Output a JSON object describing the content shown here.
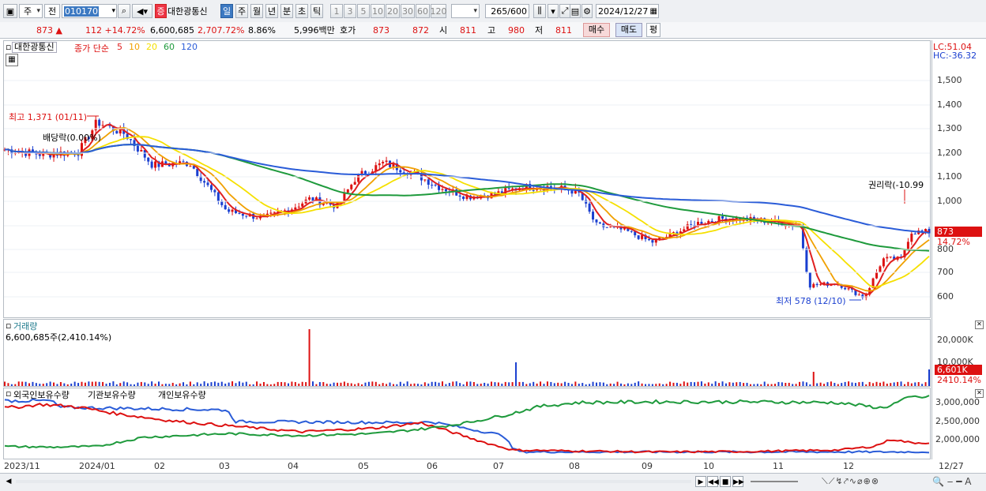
{
  "toolbar": {
    "period_type": "주",
    "prev_label": "전",
    "stock_code": "010170",
    "security_tag": "증",
    "stock_name": "대한광통신",
    "periods": [
      "일",
      "주",
      "월",
      "년",
      "분",
      "초",
      "틱"
    ],
    "minutes": [
      "1",
      "3",
      "5",
      "10",
      "20",
      "30",
      "60",
      "120"
    ],
    "count": "265",
    "count_max": "/600",
    "date": "2024/12/27"
  },
  "quote": {
    "price": "873",
    "change": "112 +14.72%",
    "volume": "6,600,685",
    "vol_ratio": "2,707.72%",
    "turnover": "8.86%",
    "amount": "5,996백만",
    "bid_label": "호가",
    "bid1": "873",
    "bid2": "872",
    "open_label": "시",
    "open": "811",
    "high_label": "고",
    "high": "980",
    "low_label": "저",
    "low": "811",
    "buy_label": "매수",
    "sell_label": "매도",
    "avg_label": "평"
  },
  "price_panel": {
    "name": "대한광통신",
    "ma_title": "종가 단순",
    "ma": [
      {
        "p": "5",
        "color": "#e02020"
      },
      {
        "p": "10",
        "color": "#f0a000"
      },
      {
        "p": "20",
        "color": "#f5e000"
      },
      {
        "p": "60",
        "color": "#1e9a3c"
      },
      {
        "p": "120",
        "color": "#2a5cd8"
      }
    ],
    "lc": "LC:51.04",
    "hc": "HC:-36.32",
    "yticks": [
      "1,500",
      "1,400",
      "1,300",
      "1,200",
      "1,100",
      "1,000",
      "800",
      "700",
      "600"
    ],
    "last_price": "873",
    "last_change": "14.72%",
    "high_note": "최고 1,371 (01/11)",
    "low_note": "최저 578 (12/10)",
    "div_note": "배당락(0.00%)",
    "rights_note": "권리락(-10.99"
  },
  "volume_panel": {
    "title": "거래량",
    "value": "6,600,685주(2,410.14%)",
    "yticks": [
      "20,000K",
      "10,000K"
    ],
    "last_vol": "6,601K",
    "last_ratio": "2410.14%"
  },
  "holding_panel": {
    "titles": [
      "외국인보유수량",
      "기관보유수량",
      "개인보유수량"
    ],
    "colors": [
      "#d11",
      "#2a5cd8",
      "#1e9a3c"
    ],
    "yticks": [
      "3,000,000",
      "2,500,000",
      "2,000,000"
    ]
  },
  "xaxis": [
    "2023/11",
    "2024/01",
    "02",
    "03",
    "04",
    "05",
    "06",
    "07",
    "08",
    "09",
    "10",
    "11",
    "12"
  ],
  "xaxis_end": "12/27",
  "colors": {
    "up": "#d11",
    "down": "#1a3fd0",
    "accent": "#3c79c2"
  }
}
